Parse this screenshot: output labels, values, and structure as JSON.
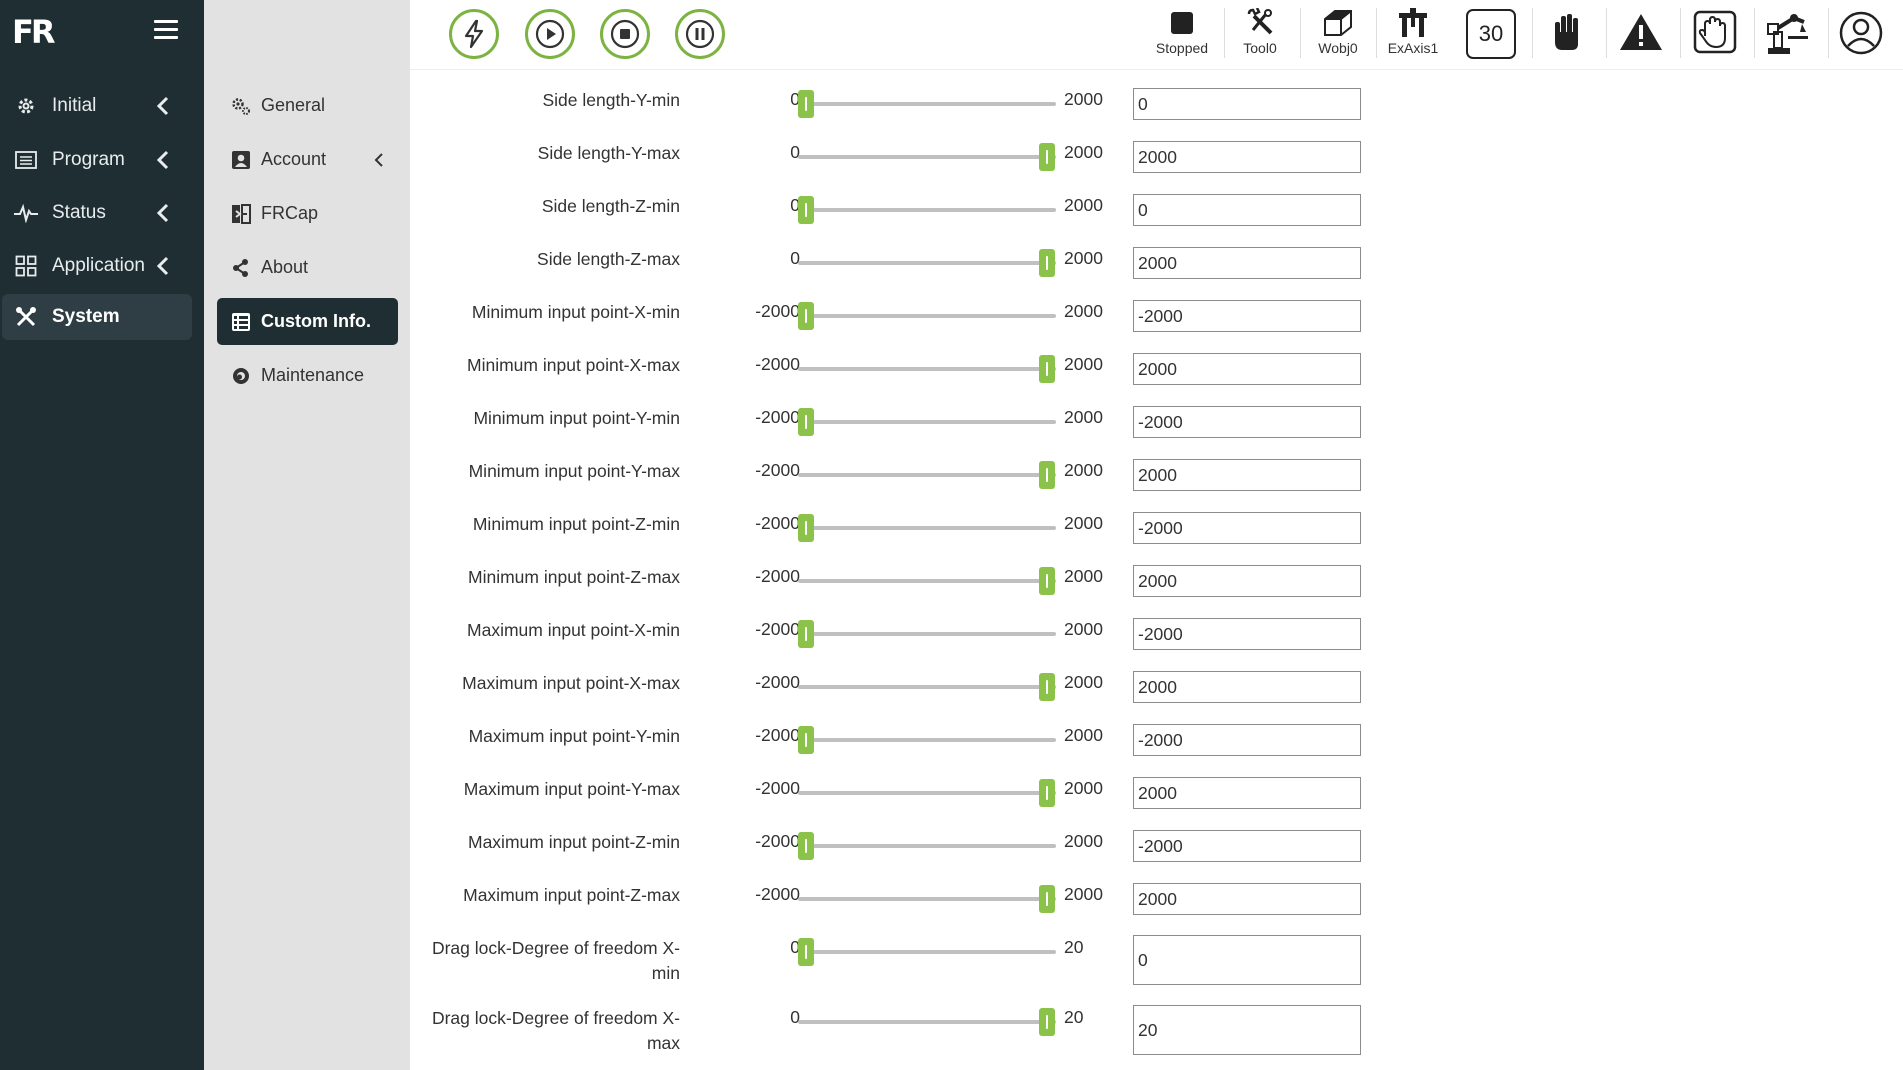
{
  "app": {
    "logo_text": "FR"
  },
  "sidebar": {
    "items": [
      {
        "label": "Initial",
        "icon": "gear-icon"
      },
      {
        "label": "Program",
        "icon": "list-icon"
      },
      {
        "label": "Status",
        "icon": "pulse-icon"
      },
      {
        "label": "Application",
        "icon": "grid-icon"
      },
      {
        "label": "System",
        "icon": "tools-icon",
        "active": true
      }
    ]
  },
  "submenu": {
    "items": [
      {
        "label": "General",
        "icon": "gears-icon"
      },
      {
        "label": "Account",
        "icon": "user-card-icon"
      },
      {
        "label": "FRCap",
        "icon": "frcap-icon"
      },
      {
        "label": "About",
        "icon": "share-icon"
      },
      {
        "label": "Custom Info.",
        "icon": "table-icon",
        "active": true
      },
      {
        "label": "Maintenance",
        "icon": "maintenance-icon"
      }
    ]
  },
  "toolbar": {
    "controls": [
      "power-icon",
      "play-icon",
      "stop-icon",
      "pause-icon"
    ],
    "status": [
      {
        "label": "Stopped",
        "icon": "stop-square-icon"
      },
      {
        "label": "Tool0",
        "icon": "wrench-icon"
      },
      {
        "label": "Wobj0",
        "icon": "cube-icon"
      },
      {
        "label": "ExAxis1",
        "icon": "axis-icon"
      }
    ],
    "speed": "30",
    "accent": "#7cb342"
  },
  "params": [
    {
      "label": "Side length-Y-min",
      "min": "0",
      "max": "2000",
      "value": "0",
      "fraction": 0
    },
    {
      "label": "Side length-Y-max",
      "min": "0",
      "max": "2000",
      "value": "2000",
      "fraction": 1
    },
    {
      "label": "Side length-Z-min",
      "min": "0",
      "max": "2000",
      "value": "0",
      "fraction": 0
    },
    {
      "label": "Side length-Z-max",
      "min": "0",
      "max": "2000",
      "value": "2000",
      "fraction": 1
    },
    {
      "label": "Minimum input point-X-min",
      "min": "-2000",
      "max": "2000",
      "value": "-2000",
      "fraction": 0
    },
    {
      "label": "Minimum input point-X-max",
      "min": "-2000",
      "max": "2000",
      "value": "2000",
      "fraction": 1
    },
    {
      "label": "Minimum input point-Y-min",
      "min": "-2000",
      "max": "2000",
      "value": "-2000",
      "fraction": 0
    },
    {
      "label": "Minimum input point-Y-max",
      "min": "-2000",
      "max": "2000",
      "value": "2000",
      "fraction": 1
    },
    {
      "label": "Minimum input point-Z-min",
      "min": "-2000",
      "max": "2000",
      "value": "-2000",
      "fraction": 0
    },
    {
      "label": "Minimum input point-Z-max",
      "min": "-2000",
      "max": "2000",
      "value": "2000",
      "fraction": 1
    },
    {
      "label": "Maximum input point-X-min",
      "min": "-2000",
      "max": "2000",
      "value": "-2000",
      "fraction": 0
    },
    {
      "label": "Maximum input point-X-max",
      "min": "-2000",
      "max": "2000",
      "value": "2000",
      "fraction": 1
    },
    {
      "label": "Maximum input point-Y-min",
      "min": "-2000",
      "max": "2000",
      "value": "-2000",
      "fraction": 0
    },
    {
      "label": "Maximum input point-Y-max",
      "min": "-2000",
      "max": "2000",
      "value": "2000",
      "fraction": 1
    },
    {
      "label": "Maximum input point-Z-min",
      "min": "-2000",
      "max": "2000",
      "value": "-2000",
      "fraction": 0
    },
    {
      "label": "Maximum input point-Z-max",
      "min": "-2000",
      "max": "2000",
      "value": "2000",
      "fraction": 1
    },
    {
      "label": "Drag lock-Degree of freedom X-min",
      "min": "0",
      "max": "20",
      "value": "0",
      "fraction": 0
    },
    {
      "label": "Drag lock-Degree of freedom X-max",
      "min": "0",
      "max": "20",
      "value": "20",
      "fraction": 1
    }
  ]
}
